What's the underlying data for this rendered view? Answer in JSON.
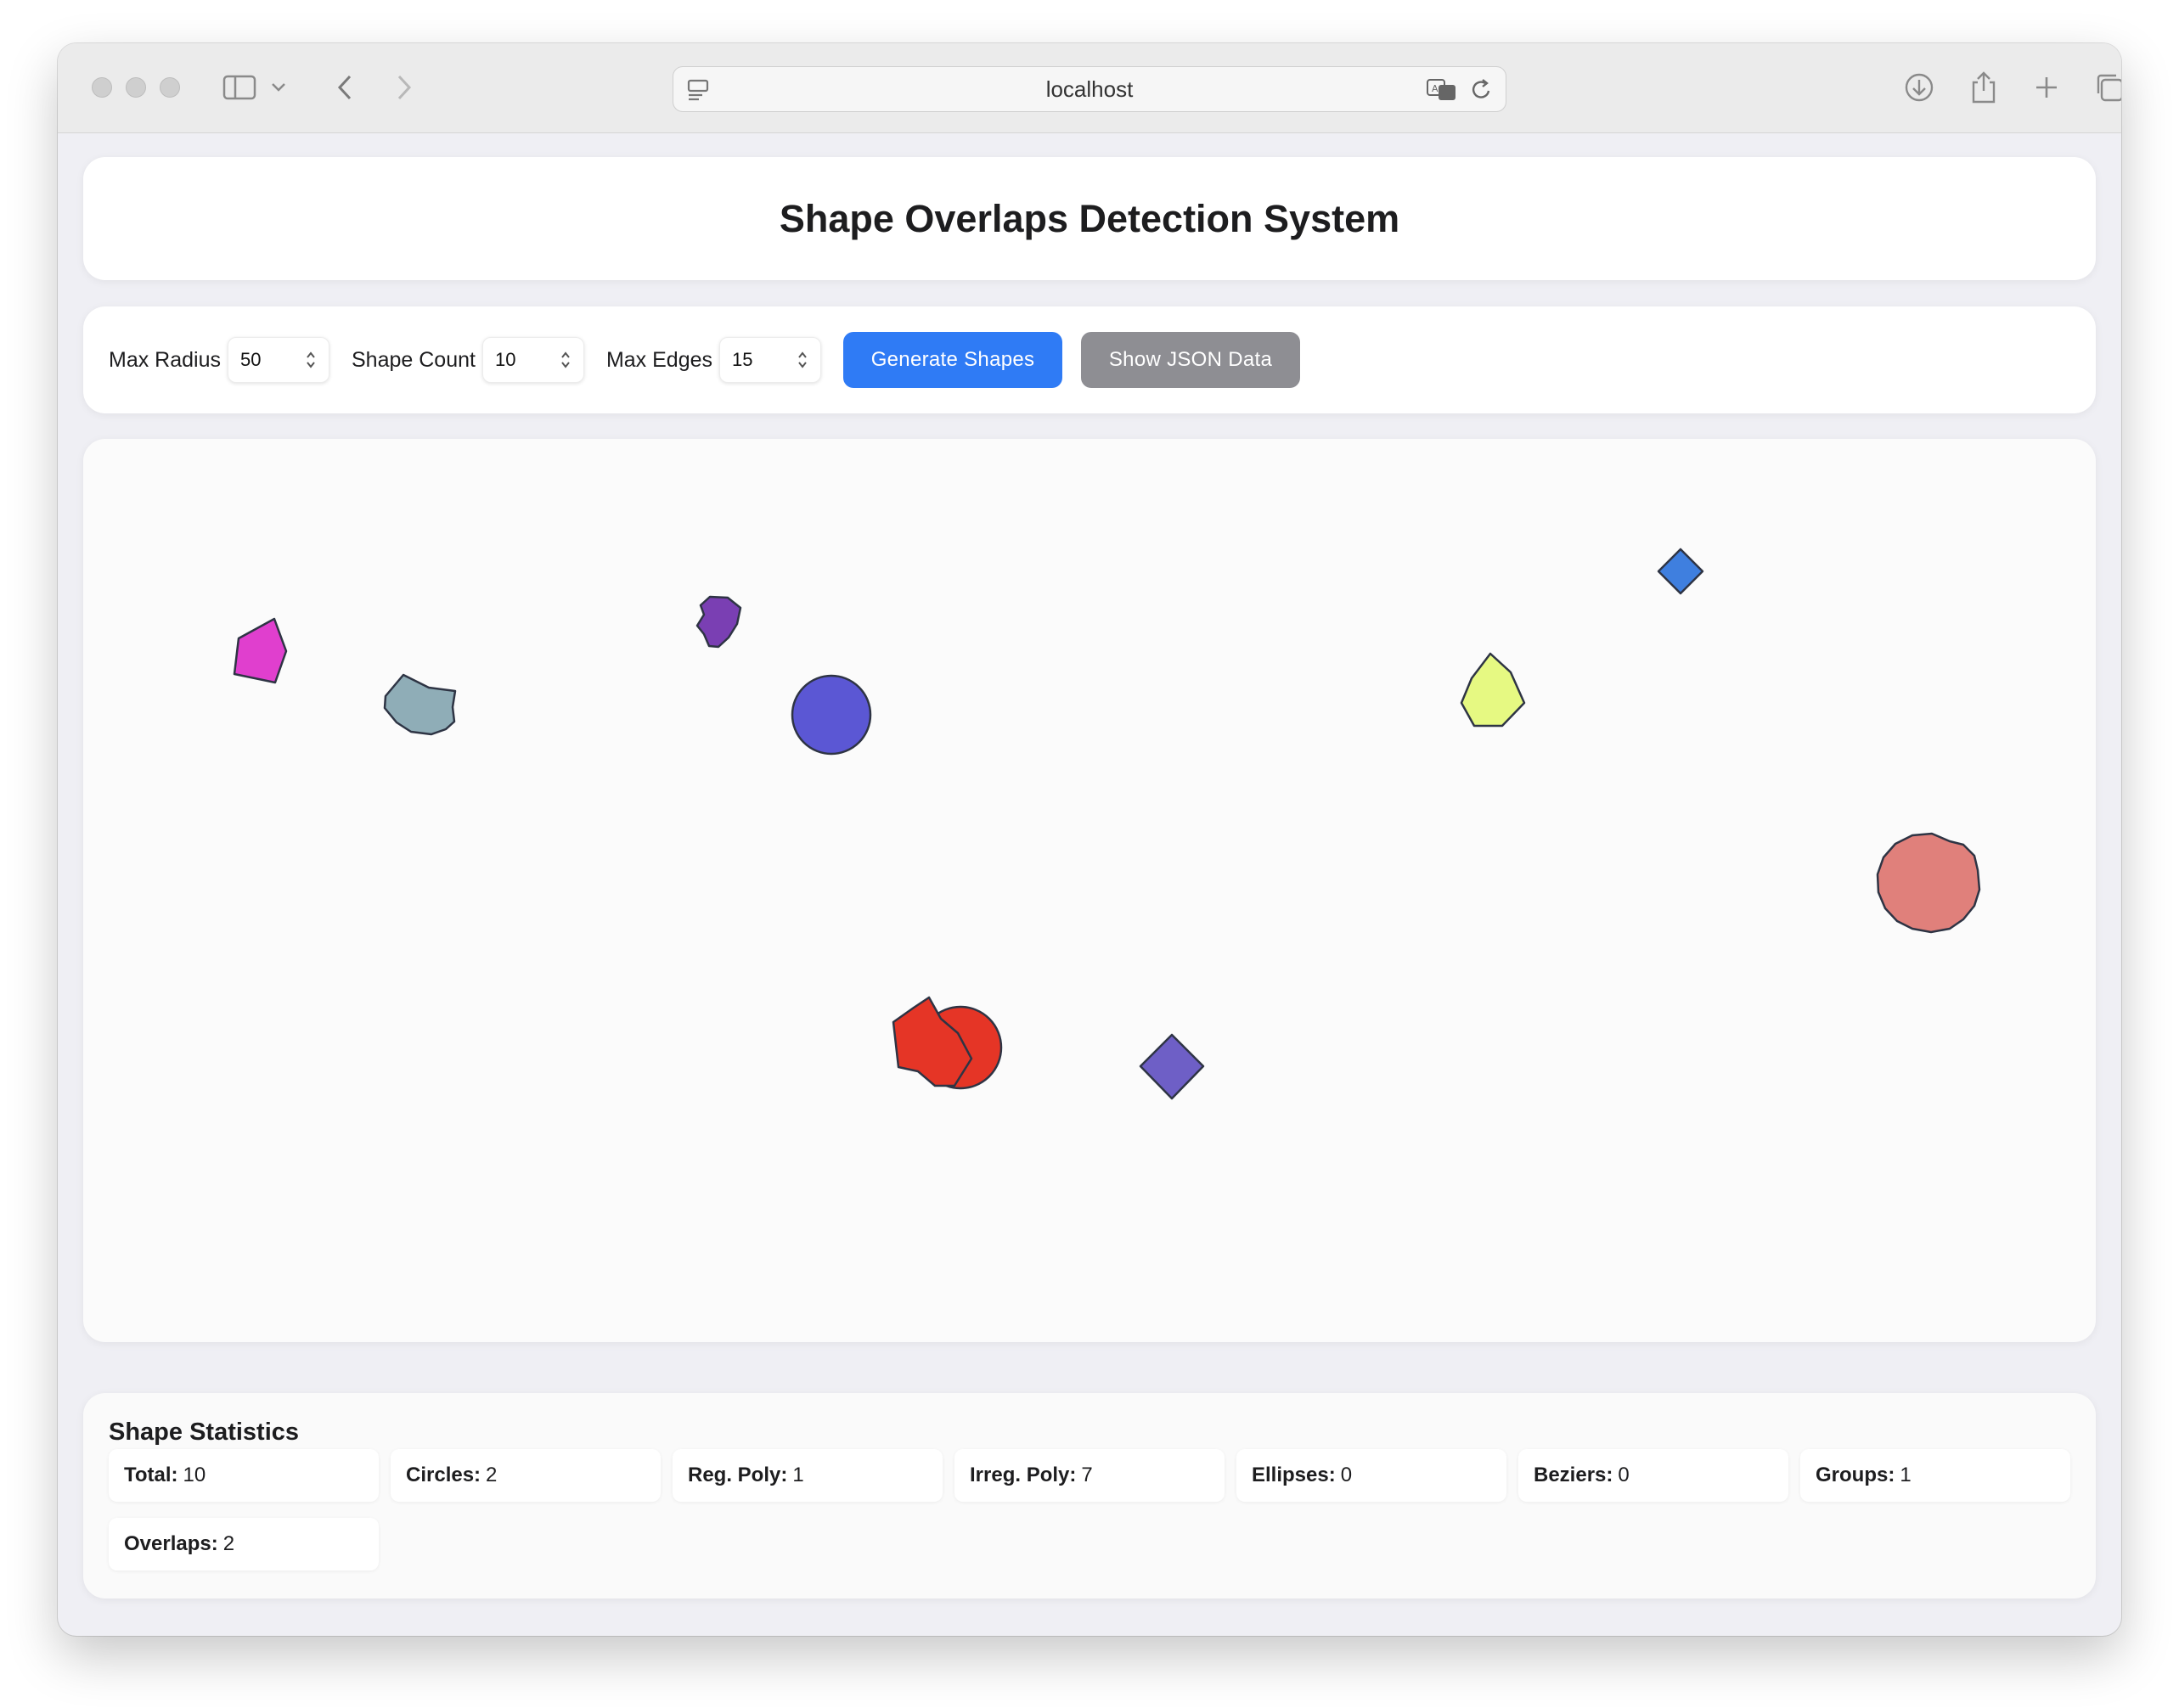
{
  "browser": {
    "url": "localhost"
  },
  "header": {
    "title": "Shape Overlaps Detection System"
  },
  "controls": {
    "max_radius_label": "Max Radius",
    "max_radius_value": "50",
    "shape_count_label": "Shape Count",
    "shape_count_value": "10",
    "max_edges_label": "Max Edges",
    "max_edges_value": "15",
    "generate_label": "Generate Shapes",
    "json_label": "Show JSON Data"
  },
  "colors": {
    "accent": "#2f7bf5",
    "secondary_button": "#8e8e93",
    "shape_stroke": "#2e3444"
  },
  "shapes": [
    {
      "kind": "irregular-polygon",
      "fill": "#e03fce",
      "icon": "pentagon"
    },
    {
      "kind": "irregular-polygon",
      "fill": "#8fadb7",
      "icon": "polygon"
    },
    {
      "kind": "irregular-polygon",
      "fill": "#7a3fb3",
      "icon": "polygon"
    },
    {
      "kind": "circle",
      "fill": "#5b57d4",
      "icon": "circle"
    },
    {
      "kind": "regular-polygon",
      "fill": "#3f7fdf",
      "icon": "diamond"
    },
    {
      "kind": "irregular-polygon",
      "fill": "#e6f982",
      "icon": "polygon"
    },
    {
      "kind": "irregular-polygon",
      "fill": "#e0807b",
      "icon": "polygon"
    },
    {
      "kind": "circle",
      "fill": "#e53526",
      "icon": "circle"
    },
    {
      "kind": "irregular-polygon",
      "fill": "#e53526",
      "icon": "polygon"
    },
    {
      "kind": "irregular-polygon",
      "fill": "#6e5fc6",
      "icon": "diamond"
    }
  ],
  "stats": {
    "title": "Shape Statistics",
    "items": [
      {
        "label": "Total:",
        "value": "10"
      },
      {
        "label": "Circles:",
        "value": "2"
      },
      {
        "label": "Reg. Poly:",
        "value": "1"
      },
      {
        "label": "Irreg. Poly:",
        "value": "7"
      },
      {
        "label": "Ellipses:",
        "value": "0"
      },
      {
        "label": "Beziers:",
        "value": "0"
      },
      {
        "label": "Groups:",
        "value": "1"
      },
      {
        "label": "Overlaps:",
        "value": "2"
      }
    ]
  }
}
